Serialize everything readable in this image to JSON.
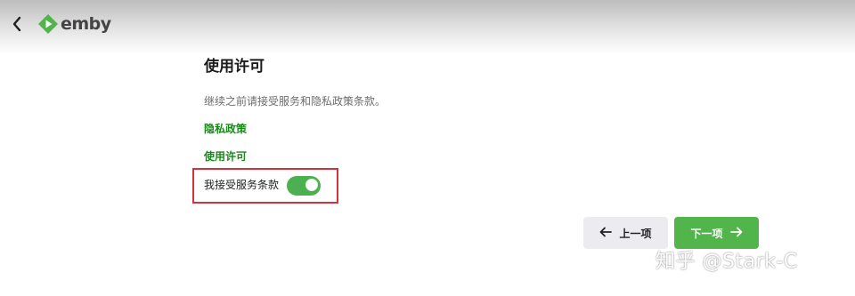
{
  "header": {
    "logo_text": "emby",
    "back_icon": "chevron-left-icon",
    "logo_icon": "emby-logo-icon"
  },
  "main": {
    "title": "使用许可",
    "description": "继续之前请接受服务和隐私政策条款。",
    "links": {
      "privacy": "隐私政策",
      "license": "使用许可"
    },
    "accept": {
      "label": "我接受服务条款",
      "checked": true
    }
  },
  "buttons": {
    "prev_label": "上一项",
    "next_label": "下一项",
    "prev_icon": "arrow-left-icon",
    "next_icon": "arrow-right-icon"
  },
  "watermark": "知乎 @Stark-C",
  "colors": {
    "accent_green": "#52b54b",
    "link_green": "#178a17",
    "highlight_red": "#d3323f"
  }
}
